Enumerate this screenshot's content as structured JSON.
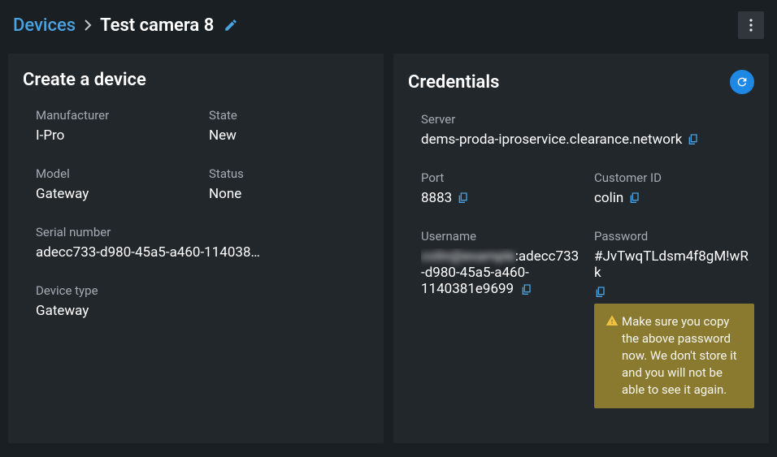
{
  "breadcrumb": {
    "root": "Devices",
    "title": "Test camera 8"
  },
  "panelLeft": {
    "title": "Create a device",
    "manufacturer_label": "Manufacturer",
    "manufacturer_value": "I-Pro",
    "state_label": "State",
    "state_value": "New",
    "model_label": "Model",
    "model_value": "Gateway",
    "status_label": "Status",
    "status_value": "None",
    "serial_label": "Serial number",
    "serial_value": "adecc733-d980-45a5-a460-114038…",
    "devicetype_label": "Device type",
    "devicetype_value": "Gateway"
  },
  "panelRight": {
    "title": "Credentials",
    "server_label": "Server",
    "server_value": "dems-proda-iproservice.clearance.network",
    "port_label": "Port",
    "port_value": "8883",
    "customer_label": "Customer ID",
    "customer_value": "colin",
    "username_label": "Username",
    "username_blurred": "colin@example",
    "username_visible": ":adecc733-d980-45a5-a460-1140381e9699",
    "password_label": "Password",
    "password_value": "#JvTwqTLdsm4f8gM!wRk",
    "warning_text": "Make sure you copy the above password now. We don't store it and you will not be able to see it again."
  }
}
